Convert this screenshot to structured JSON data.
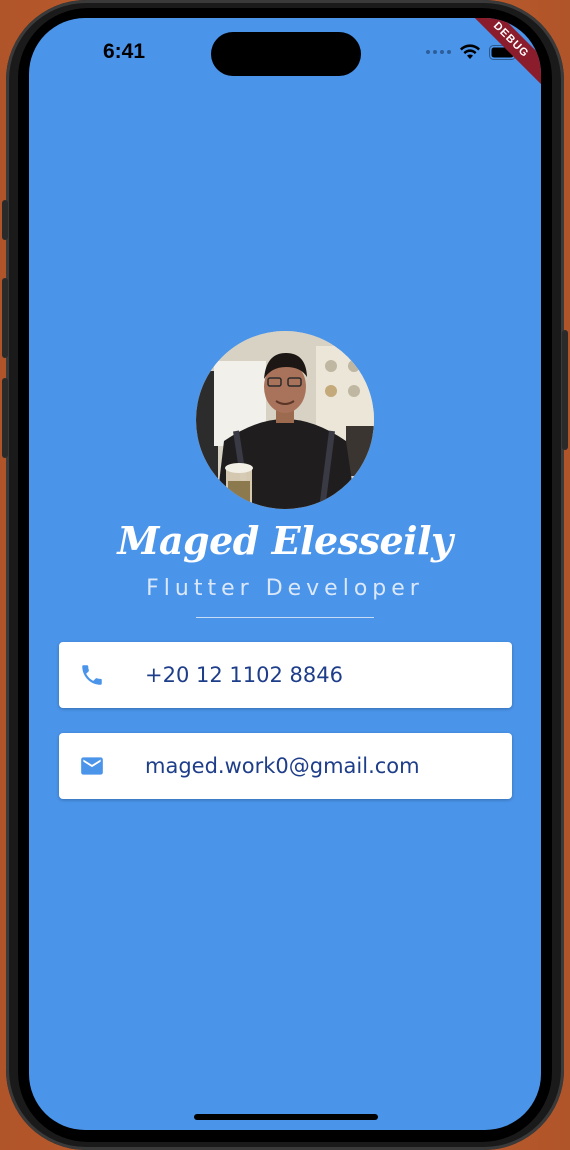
{
  "status_bar": {
    "time": "6:41",
    "debug_label": "DEBUG"
  },
  "profile": {
    "name": "Maged Elesseily",
    "role": "Flutter Developer"
  },
  "contacts": [
    {
      "icon": "phone-icon",
      "text": "+20 12 1102 8846"
    },
    {
      "icon": "mail-icon",
      "text": "maged.work0@gmail.com"
    }
  ],
  "colors": {
    "background": "#4a94ea",
    "card_text": "#1f3e8a",
    "icon": "#4a94ea"
  }
}
